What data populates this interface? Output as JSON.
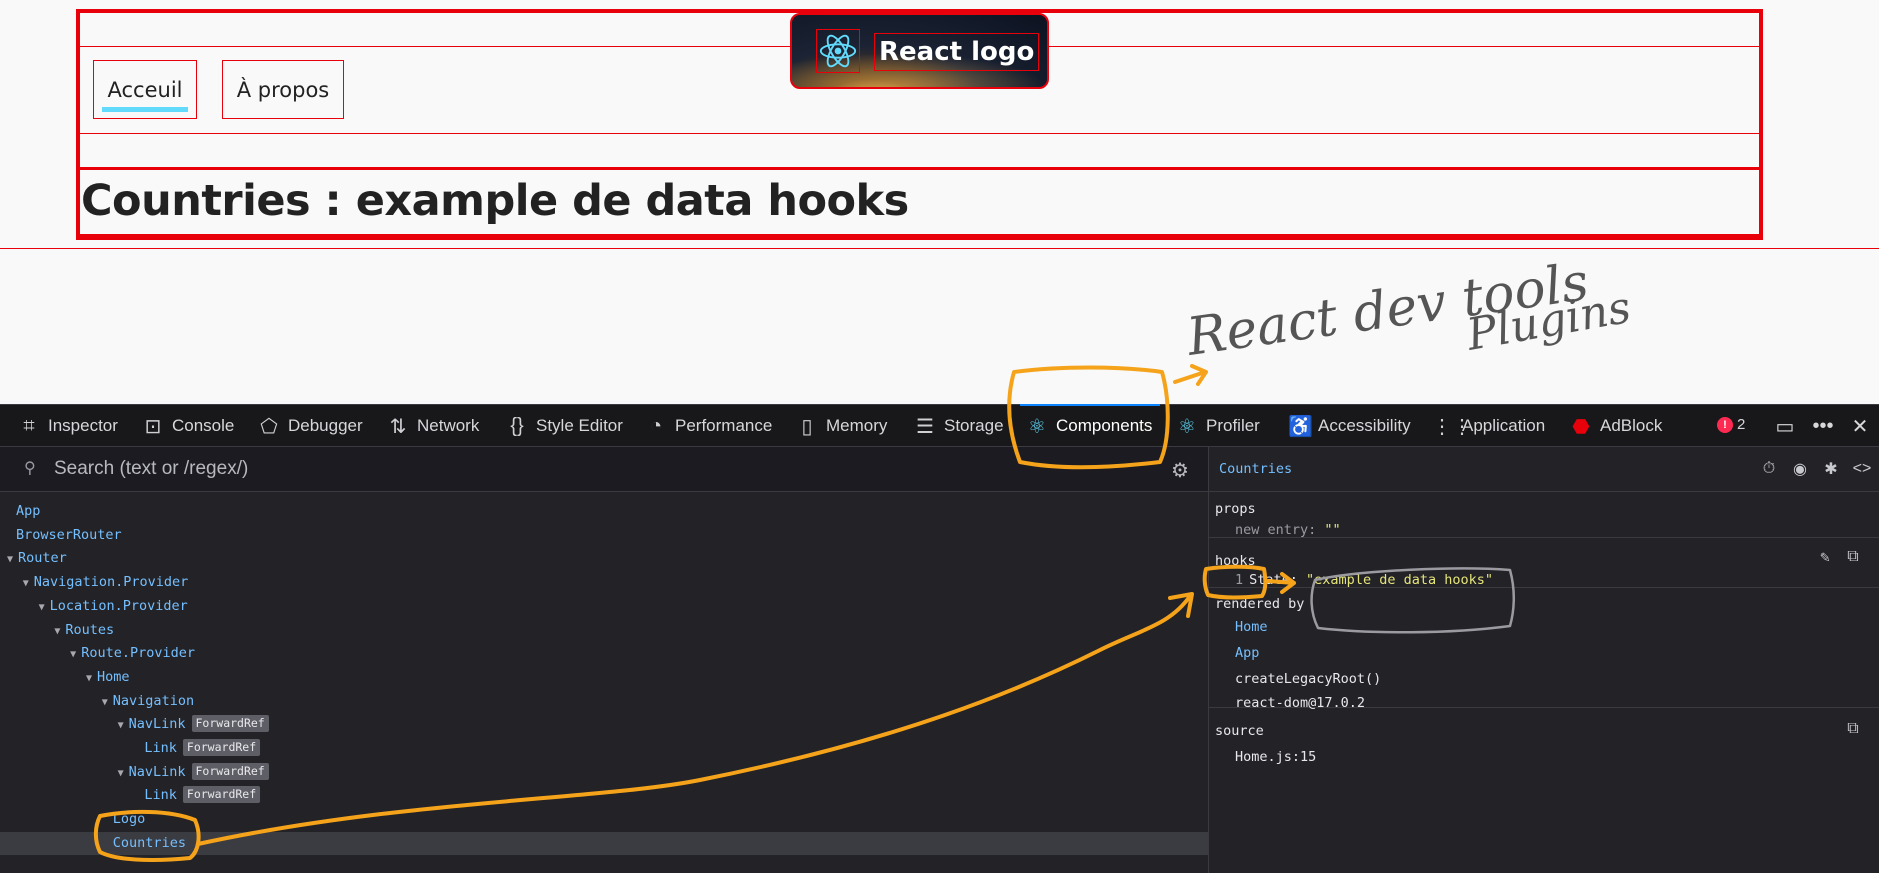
{
  "page": {
    "nav": {
      "home_label": "Acceuil",
      "about_label": "À propos"
    },
    "logo_text": "React logo",
    "title": "Countries : example de data hooks"
  },
  "annotation": {
    "handwritten_note": "React dev tools Plugins",
    "color": "#f5a31a"
  },
  "devtools": {
    "tabs": [
      {
        "label": "Inspector",
        "icon": "inspector-icon"
      },
      {
        "label": "Console",
        "icon": "console-icon"
      },
      {
        "label": "Debugger",
        "icon": "debugger-icon"
      },
      {
        "label": "Network",
        "icon": "network-icon"
      },
      {
        "label": "Style Editor",
        "icon": "style-editor-icon"
      },
      {
        "label": "Performance",
        "icon": "performance-icon"
      },
      {
        "label": "Memory",
        "icon": "memory-icon"
      },
      {
        "label": "Storage",
        "icon": "storage-icon"
      },
      {
        "label": "Components",
        "icon": "react-icon",
        "active": true
      },
      {
        "label": "Profiler",
        "icon": "react-icon"
      },
      {
        "label": "Accessibility",
        "icon": "accessibility-icon"
      },
      {
        "label": "Application",
        "icon": "application-icon"
      },
      {
        "label": "AdBlock",
        "icon": "adblock-icon"
      }
    ],
    "error_count": "2",
    "search": {
      "placeholder": "Search (text or /regex/)"
    },
    "tree": [
      {
        "name": "App",
        "depth": 0
      },
      {
        "name": "BrowserRouter",
        "depth": 0
      },
      {
        "name": "Router",
        "depth": 0,
        "arrow": true
      },
      {
        "name": "Navigation.Provider",
        "depth": 1,
        "arrow": true
      },
      {
        "name": "Location.Provider",
        "depth": 2,
        "arrow": true
      },
      {
        "name": "Routes",
        "depth": 3,
        "arrow": true
      },
      {
        "name": "Route.Provider",
        "depth": 4,
        "arrow": true
      },
      {
        "name": "Home",
        "depth": 5,
        "arrow": true
      },
      {
        "name": "Navigation",
        "depth": 6,
        "arrow": true
      },
      {
        "name": "NavLink",
        "depth": 7,
        "arrow": true,
        "badge": "ForwardRef"
      },
      {
        "name": "Link",
        "depth": 8,
        "badge": "ForwardRef"
      },
      {
        "name": "NavLink",
        "depth": 7,
        "arrow": true,
        "badge": "ForwardRef"
      },
      {
        "name": "Link",
        "depth": 8,
        "badge": "ForwardRef"
      },
      {
        "name": "Logo",
        "depth": 6
      },
      {
        "name": "Countries",
        "depth": 6,
        "selected": true
      }
    ],
    "selected_component": "Countries",
    "props": {
      "heading": "props",
      "key": "new entry",
      "value": "\"\""
    },
    "hooks": {
      "heading": "hooks",
      "index": "1",
      "key": "State",
      "value": "\"example de data hooks\""
    },
    "rendered_by": {
      "heading": "rendered by",
      "items": [
        "Home",
        "App",
        "createLegacyRoot()",
        "react-dom@17.0.2"
      ]
    },
    "source": {
      "heading": "source",
      "value": "Home.js:15"
    }
  }
}
